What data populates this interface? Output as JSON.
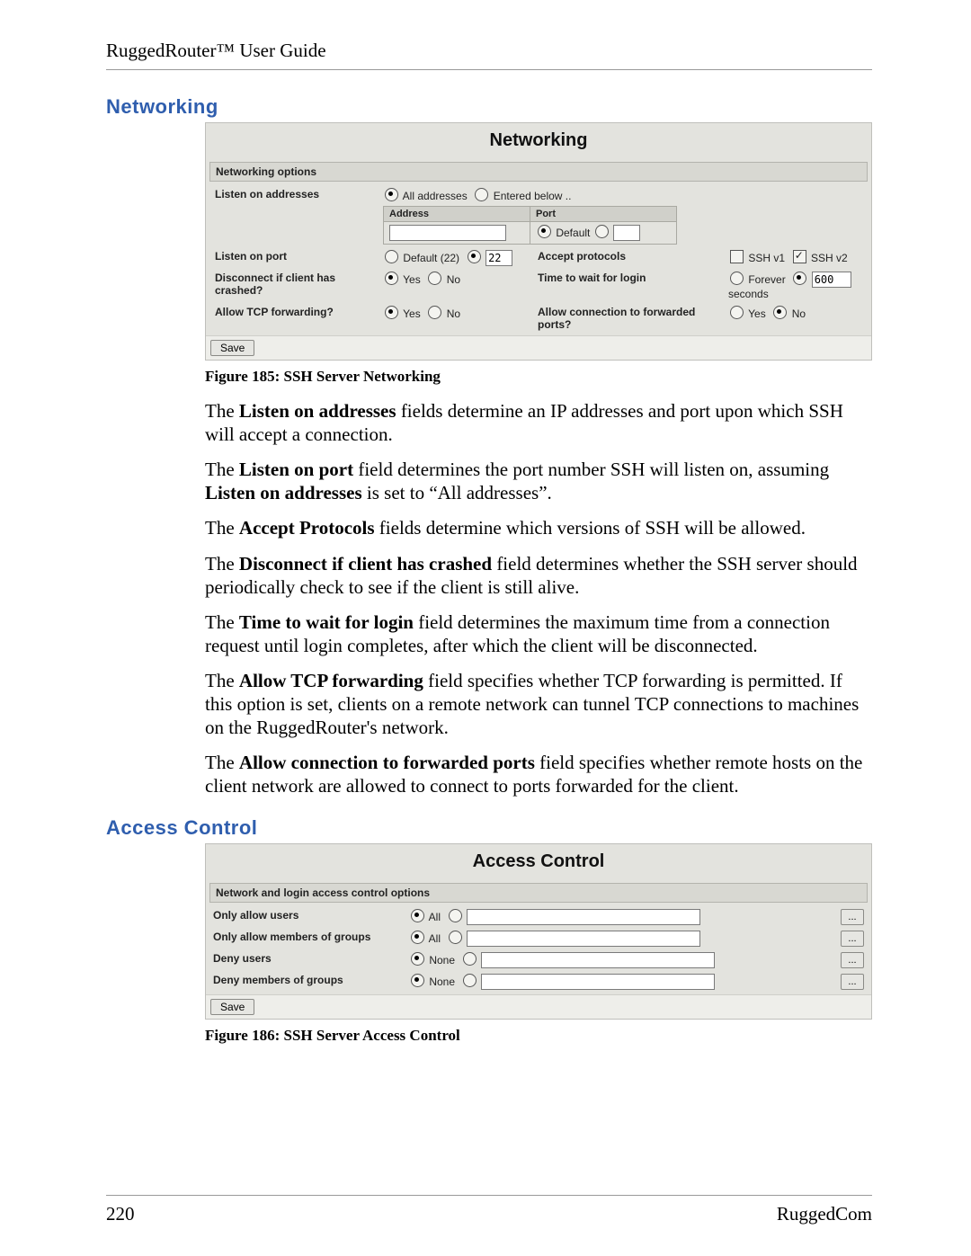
{
  "header": {
    "title": "RuggedRouter™ User Guide"
  },
  "footer": {
    "page": "220",
    "brand": "RuggedCom"
  },
  "networking": {
    "section_heading": "Networking",
    "panel_title": "Networking",
    "options_bar": "Networking options",
    "labels": {
      "listen_addresses": "Listen on addresses",
      "listen_port": "Listen on port",
      "disconnect": "Disconnect if client has crashed?",
      "allow_tcp": "Allow TCP forwarding?",
      "accept_protocols": "Accept protocols",
      "time_wait": "Time to wait for login",
      "allow_fwd_ports": "Allow connection to forwarded ports?"
    },
    "listen_addr": {
      "opt_all": "All addresses",
      "opt_entered": "Entered below ..",
      "col_address": "Address",
      "col_port": "Port",
      "port_default": "Default"
    },
    "listen_port": {
      "default_label": "Default (22)",
      "value": "22"
    },
    "yes": "Yes",
    "no": "No",
    "protocols": {
      "v1": "SSH v1",
      "v2": "SSH v2"
    },
    "time_wait": {
      "forever": "Forever",
      "value": "600",
      "unit": "seconds"
    },
    "save": "Save",
    "caption": "Figure 185: SSH Server Networking"
  },
  "paragraphs": {
    "p1a": "The ",
    "p1b": "Listen on addresses",
    "p1c": " fields determine an IP addresses and port upon which SSH will accept a connection.",
    "p2a": "The ",
    "p2b": "Listen on port",
    "p2c": " field determines the port number SSH will listen on, assuming ",
    "p2d": "Listen on addresses",
    "p2e": " is set to “All addresses”.",
    "p3a": "The ",
    "p3b": "Accept Protocols",
    "p3c": " fields determine which versions of SSH will be allowed.",
    "p4a": "The ",
    "p4b": "Disconnect if client has crashed",
    "p4c": " field determines whether the SSH server should periodically check to see if the client is still alive.",
    "p5a": "The ",
    "p5b": "Time to wait for login",
    "p5c": " field determines the maximum time from a connection request until login completes, after which the client will be disconnected.",
    "p6a": "The ",
    "p6b": "Allow TCP forwarding",
    "p6c": " field specifies whether TCP forwarding is permitted.  If this option is set, clients on a remote network can tunnel TCP connections to machines on the RuggedRouter's network.",
    "p7a": "The ",
    "p7b": "Allow connection to forwarded ports",
    "p7c": " field specifies whether remote hosts on the client network are allowed to connect to ports forwarded for the client."
  },
  "access": {
    "section_heading": "Access Control",
    "panel_title": "Access Control",
    "options_bar": "Network and login access control options",
    "rows": {
      "allow_users": "Only allow users",
      "allow_groups": "Only allow members of groups",
      "deny_users": "Deny users",
      "deny_groups": "Deny members of groups"
    },
    "opt_all": "All",
    "opt_none": "None",
    "ellipsis": "...",
    "save": "Save",
    "caption": "Figure 186: SSH Server Access Control"
  }
}
